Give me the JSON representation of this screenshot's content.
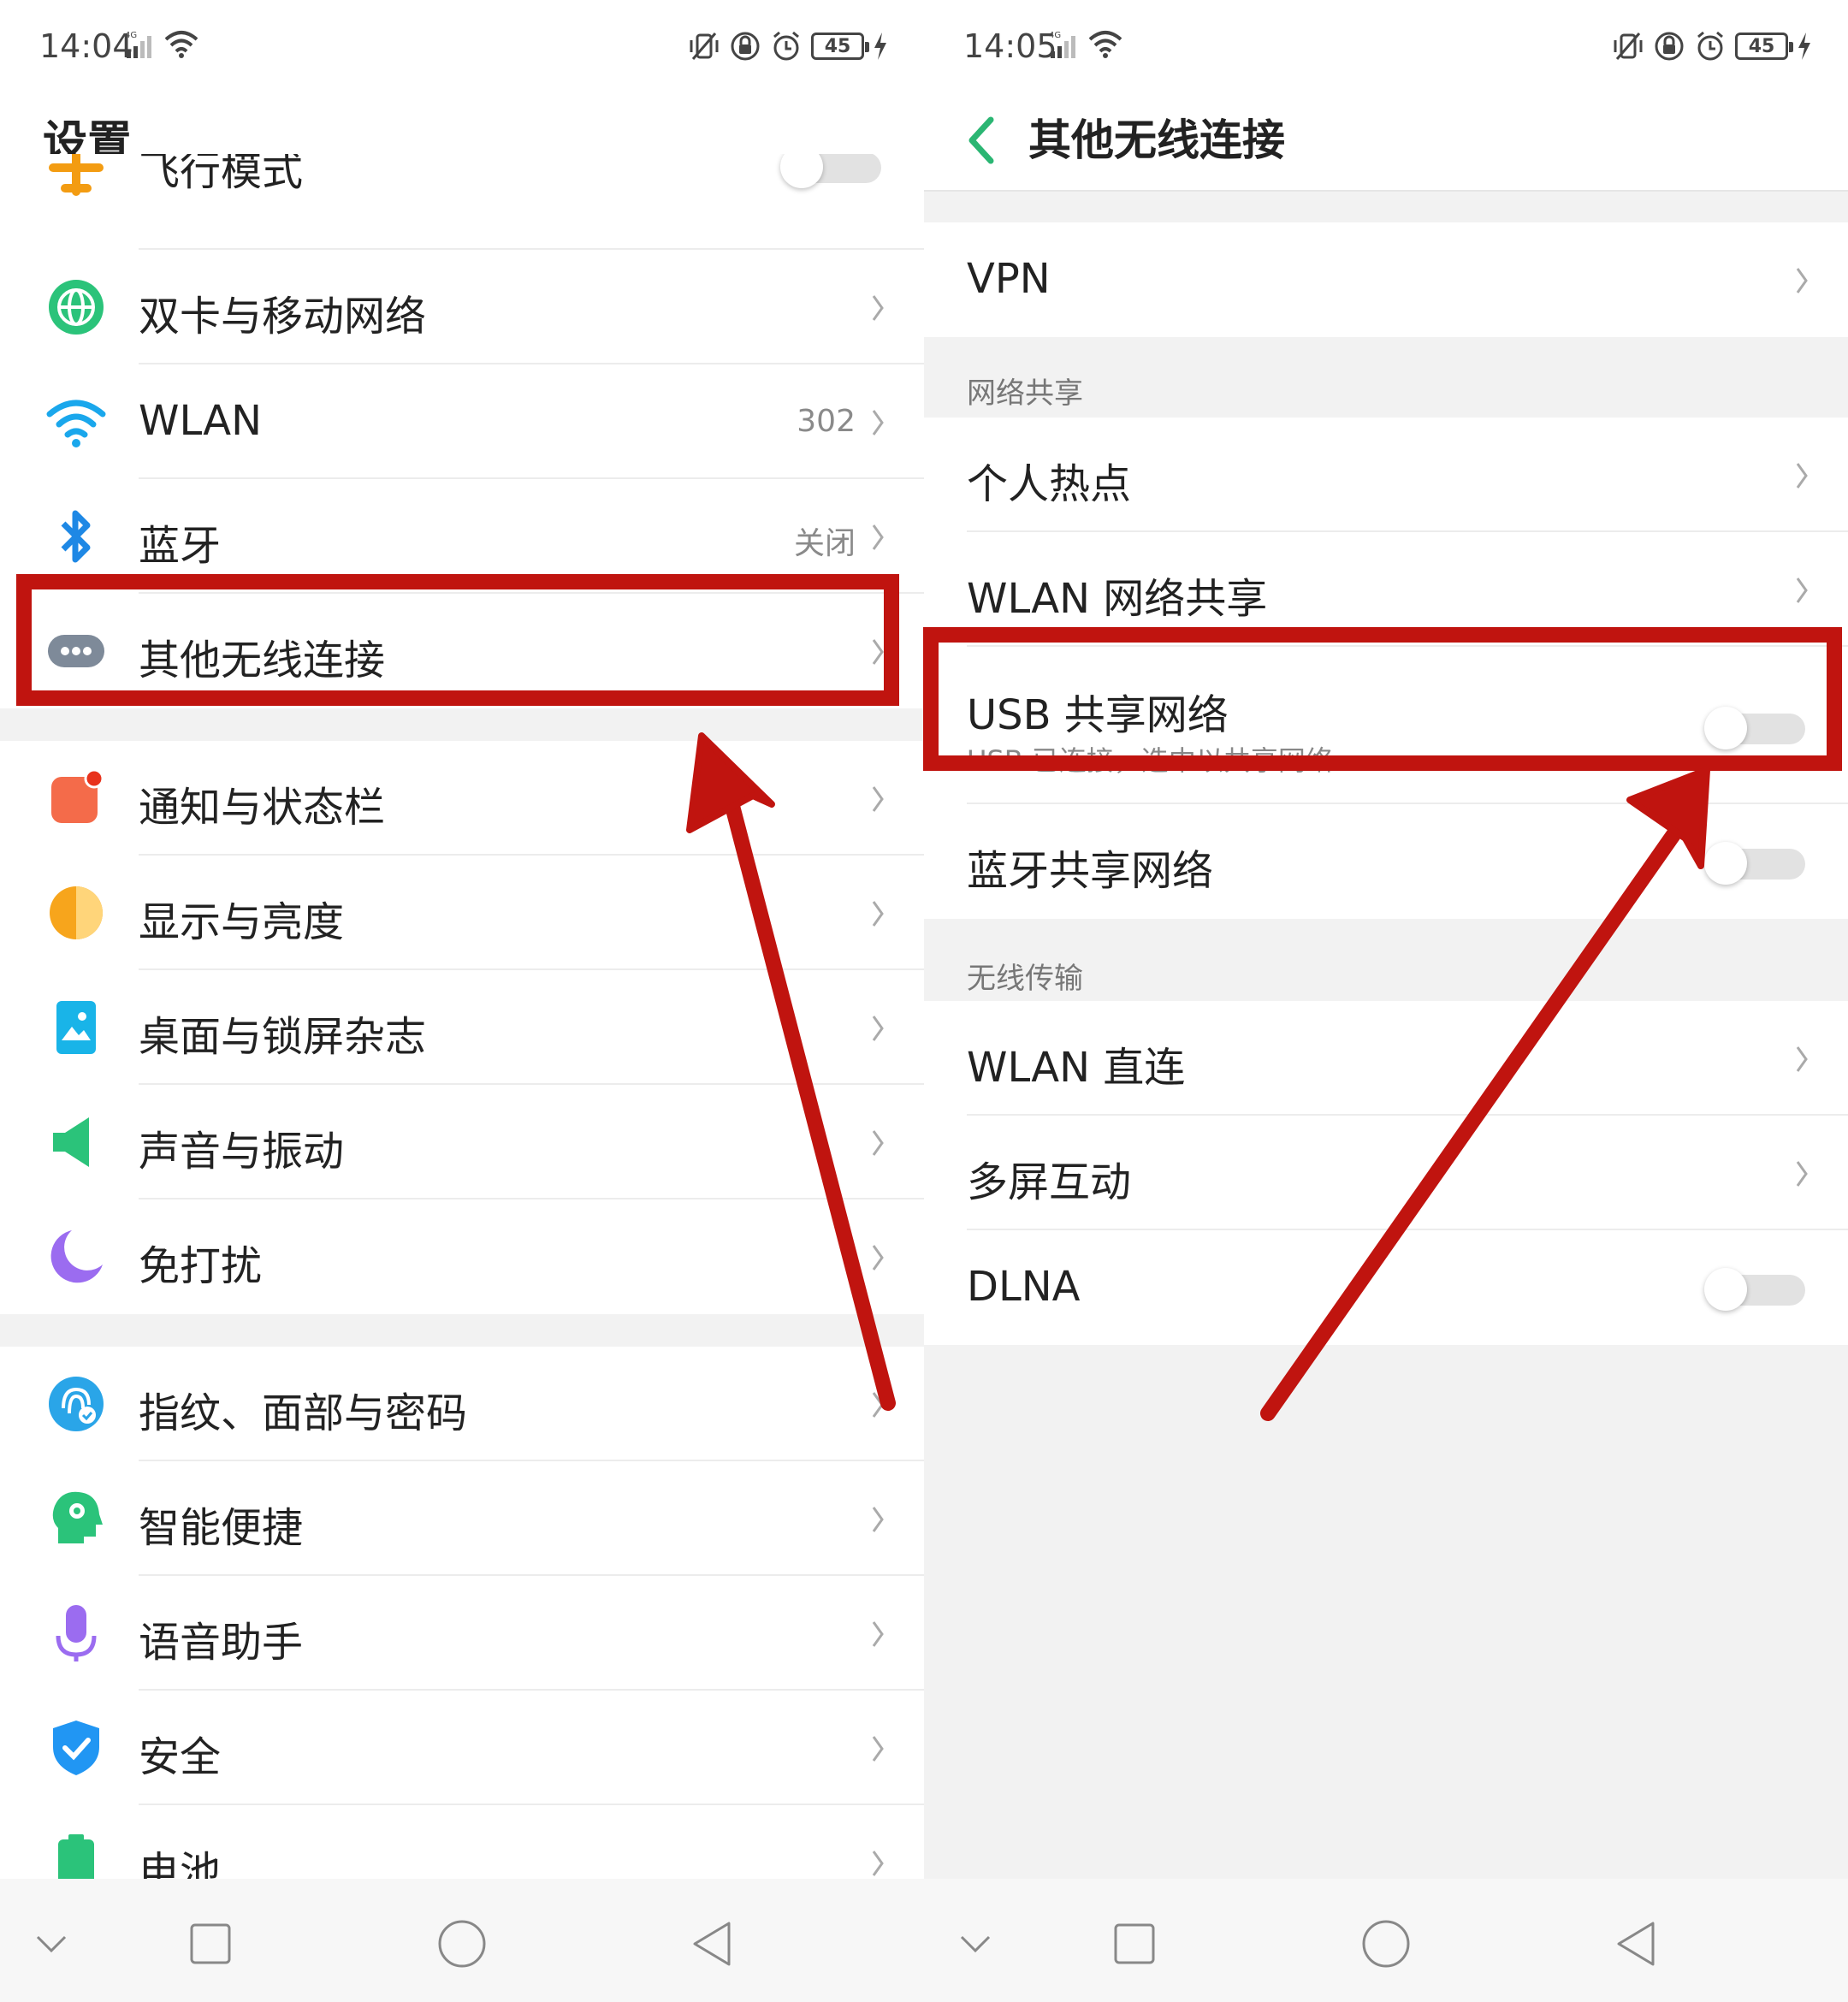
{
  "colors": {
    "accent_green": "#2bb673",
    "highlight_red": "#c0140f",
    "text_primary": "#222222",
    "text_secondary": "#8a8a8a"
  },
  "left": {
    "status": {
      "time": "14:04",
      "network": "4G",
      "battery": "45"
    },
    "title": "设置",
    "partial_top_label": "飞行模式",
    "items": [
      {
        "label": "双卡与移动网络",
        "icon": "globe-icon"
      },
      {
        "label": "WLAN",
        "value": "302",
        "icon": "wifi-icon"
      },
      {
        "label": "蓝牙",
        "value": "关闭",
        "icon": "bluetooth-icon"
      },
      {
        "label": "其他无线连接",
        "icon": "more-dots-icon"
      },
      {
        "label": "通知与状态栏",
        "icon": "notification-icon"
      },
      {
        "label": "显示与亮度",
        "icon": "brightness-icon"
      },
      {
        "label": "桌面与锁屏杂志",
        "icon": "wallpaper-icon"
      },
      {
        "label": "声音与振动",
        "icon": "speaker-icon"
      },
      {
        "label": "免打扰",
        "icon": "moon-icon"
      },
      {
        "label": "指纹、面部与密码",
        "icon": "fingerprint-icon"
      },
      {
        "label": "智能便捷",
        "icon": "smart-head-icon"
      },
      {
        "label": "语音助手",
        "icon": "microphone-icon"
      },
      {
        "label": "安全",
        "icon": "shield-icon"
      },
      {
        "label": "电池",
        "icon": "battery-icon"
      }
    ]
  },
  "right": {
    "status": {
      "time": "14:05",
      "network": "4G",
      "battery": "45"
    },
    "title": "其他无线连接",
    "vpn": "VPN",
    "section_sharing": "网络共享",
    "hotspot": "个人热点",
    "wlan_share": "WLAN 网络共享",
    "usb_share": "USB 共享网络",
    "usb_share_sub": "USB 已连接，选中以共享网络",
    "bt_share": "蓝牙共享网络",
    "section_transfer": "无线传输",
    "wlan_direct": "WLAN 直连",
    "multiscreen": "多屏互动",
    "dlna": "DLNA",
    "toggles": {
      "usb_share": false,
      "bt_share": false,
      "dlna": false
    }
  }
}
